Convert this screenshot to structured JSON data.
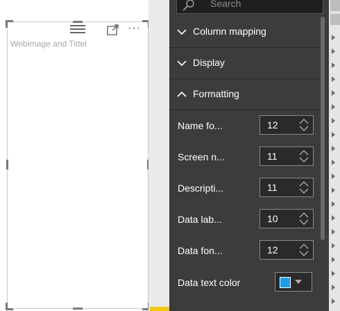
{
  "visual": {
    "title": "WebImage and Tittel"
  },
  "format_pane": {
    "search": {
      "placeholder": "Search"
    },
    "sections": [
      {
        "label": "Column mapping",
        "state": "collapsed"
      },
      {
        "label": "Display",
        "state": "collapsed"
      },
      {
        "label": "Formatting",
        "state": "expanded"
      }
    ],
    "formatting": {
      "name_font": {
        "label": "Name fo...",
        "value": "12"
      },
      "screen_name": {
        "label": "Screen n...",
        "value": "11"
      },
      "description": {
        "label": "Descripti...",
        "value": "11"
      },
      "data_label": {
        "label": "Data lab...",
        "value": "10"
      },
      "data_font": {
        "label": "Data fon...",
        "value": "12"
      },
      "data_text_color": {
        "label": "Data text color",
        "color": "#1e9de6"
      }
    }
  },
  "icons": {
    "drag": "drag-handle-icon",
    "focus": "focus-mode-icon",
    "more": "more-options-icon",
    "search": "search-icon",
    "chevron_down": "chevron-down-icon",
    "chevron_up": "chevron-up-icon",
    "spinner": "spinner-arrows-icon",
    "dropdown": "dropdown-caret-icon"
  },
  "colors": {
    "pane_bg": "#3c3c3c",
    "canvas_bg": "#ffffff",
    "accent_yellow": "#f2c811"
  }
}
